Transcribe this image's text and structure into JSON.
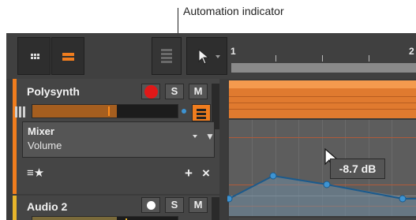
{
  "callout": {
    "label": "Automation indicator"
  },
  "ruler": {
    "marks": [
      "1",
      "2"
    ]
  },
  "tracks": [
    {
      "name": "Polysynth",
      "color": "#f07d1e",
      "record_color": "#e01818",
      "solo_label": "S",
      "mute_label": "M",
      "meter_fill": 0.58,
      "automation_indicator": "blue-dot"
    },
    {
      "name": "Audio 2",
      "color": "#e8b52b",
      "record_color": "#ffffff",
      "solo_label": "S",
      "mute_label": "M"
    }
  ],
  "automation_panel": {
    "device": "Mixer",
    "parameter": "Volume",
    "add_label": "+",
    "close_label": "×"
  },
  "automation": {
    "tooltip_value": "-8.7 dB",
    "line_color": "#1b5a8c",
    "point_color": "#3d93d2"
  },
  "colors": {
    "accent": "#f07d1e",
    "clip": "#e07a2f",
    "background": "#3b3b3b"
  }
}
